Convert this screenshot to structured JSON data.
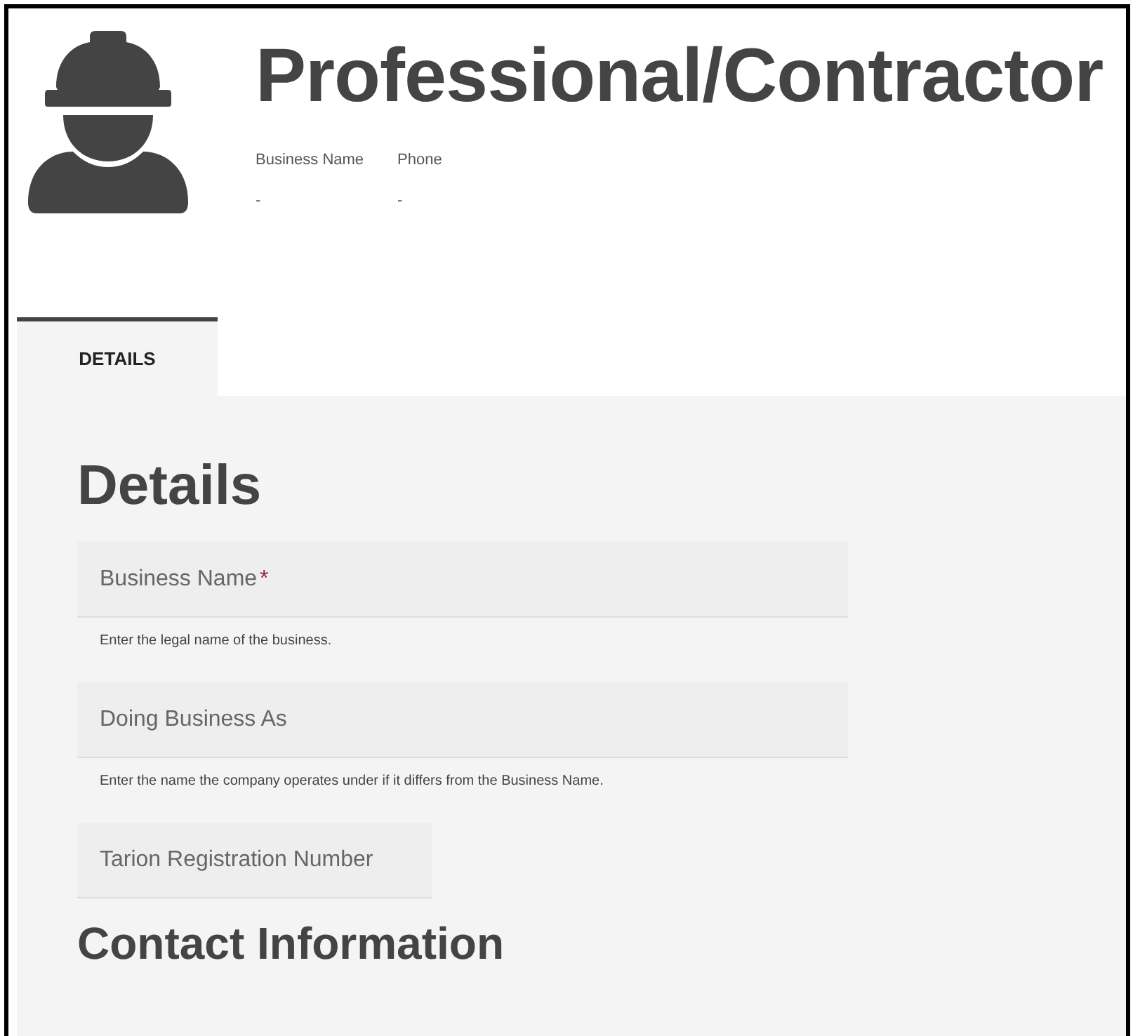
{
  "header": {
    "title": "Professional/Contractor",
    "info": [
      {
        "label": "Business Name",
        "value": "-"
      },
      {
        "label": "Phone",
        "value": "-"
      }
    ]
  },
  "tabs": [
    {
      "label": "DETAILS",
      "selected": true
    }
  ],
  "section": {
    "title": "Details",
    "fields": [
      {
        "label": "Business Name",
        "required_mark": "*",
        "hint": "Enter the legal name of the business.",
        "kind": "wide"
      },
      {
        "label": "Doing Business As",
        "hint": "Enter the name the company operates under if it differs from the Business Name.",
        "kind": "wide"
      },
      {
        "label": "Tarion Registration Number",
        "kind": "short"
      }
    ]
  },
  "next_section": {
    "title": "Contact Information"
  }
}
